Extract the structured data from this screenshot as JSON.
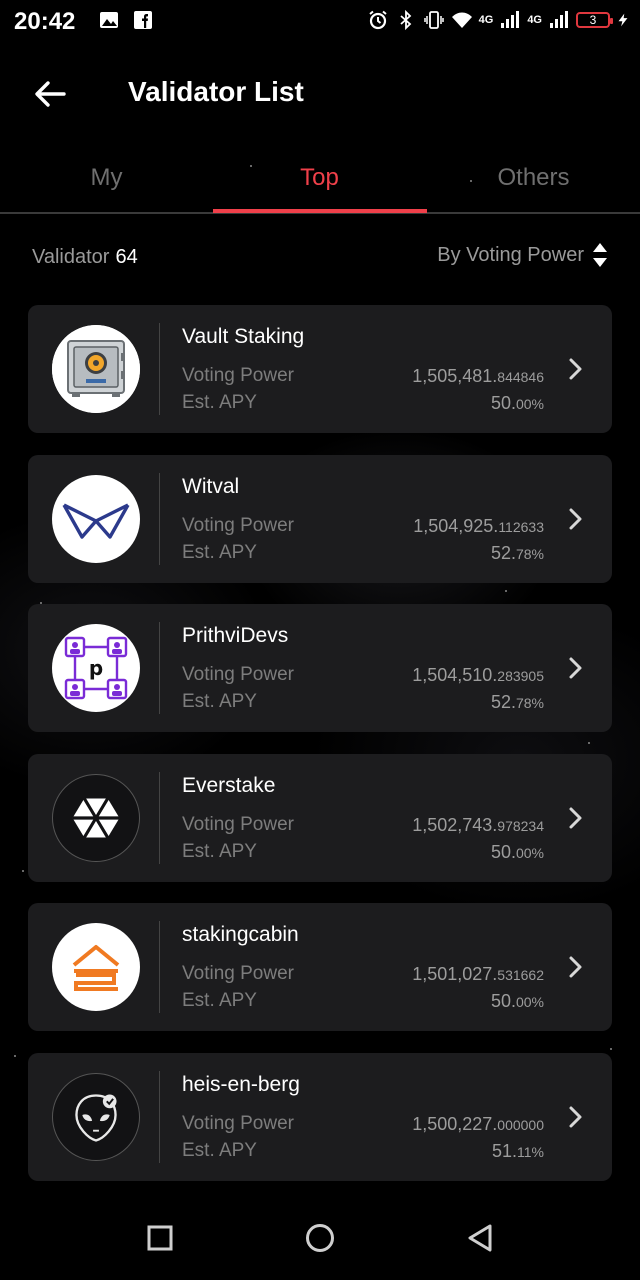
{
  "status_bar": {
    "time": "20:42",
    "network_1": "4G",
    "network_2": "4G",
    "battery_level": "3"
  },
  "header": {
    "title": "Validator List",
    "back_icon": "arrow-left-icon"
  },
  "tabs": [
    {
      "label": "My",
      "active": false
    },
    {
      "label": "Top",
      "active": true
    },
    {
      "label": "Others",
      "active": false
    }
  ],
  "summary": {
    "count_label": "Validator",
    "count_value": "64",
    "sort_label": "By Voting Power",
    "sort_icon": "sort-updown-icon"
  },
  "labels": {
    "voting_power": "Voting Power",
    "est_apy": "Est. APY"
  },
  "colors": {
    "accent": "#f0404a",
    "card_bg": "#1c1c1e",
    "muted_text": "#7d7d7d"
  },
  "validators": [
    {
      "name": "Vault Staking",
      "power_int": "1,505,481.",
      "power_dec": "844846",
      "apy_int": "50.",
      "apy_dec": "00%",
      "logo": "vault-safe-icon"
    },
    {
      "name": "Witval",
      "power_int": "1,504,925.",
      "power_dec": "112633",
      "apy_int": "52.",
      "apy_dec": "78%",
      "logo": "witval-w-icon"
    },
    {
      "name": "PrithviDevs",
      "power_int": "1,504,510.",
      "power_dec": "283905",
      "apy_int": "52.",
      "apy_dec": "78%",
      "logo": "prithvidevs-network-icon",
      "logo_letter": "p"
    },
    {
      "name": "Everstake",
      "power_int": "1,502,743.",
      "power_dec": "978234",
      "apy_int": "50.",
      "apy_dec": "00%",
      "logo": "everstake-hexagon-icon"
    },
    {
      "name": "stakingcabin",
      "power_int": "1,501,027.",
      "power_dec": "531662",
      "apy_int": "50.",
      "apy_dec": "00%",
      "logo": "stakingcabin-house-icon"
    },
    {
      "name": "heis-en-berg",
      "power_int": "1,500,227.",
      "power_dec": "000000",
      "apy_int": "51.",
      "apy_dec": "11%",
      "logo": "alien-head-icon"
    }
  ],
  "nav_bar": {
    "recents": "square-icon",
    "home": "circle-icon",
    "back": "triangle-back-icon"
  }
}
